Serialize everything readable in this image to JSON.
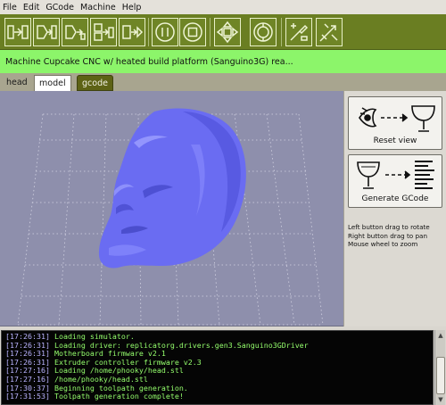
{
  "menubar": {
    "items": [
      "File",
      "Edit",
      "GCode",
      "Machine",
      "Help"
    ]
  },
  "toolbar": {
    "buttons": [
      {
        "name": "simulate-button",
        "icon": "simulate-icon"
      },
      {
        "name": "build-button",
        "icon": "build-icon"
      },
      {
        "name": "upload-button",
        "icon": "upload-icon"
      },
      {
        "name": "build-to-file-button",
        "icon": "build-to-file-icon"
      },
      {
        "name": "build-from-file-button",
        "icon": "build-from-file-icon"
      },
      {
        "name": "pause-button",
        "icon": "pause-icon"
      },
      {
        "name": "stop-button",
        "icon": "stop-icon"
      },
      {
        "name": "control-panel-button",
        "icon": "jog-arrows-icon"
      },
      {
        "name": "reset-button",
        "icon": "reset-icon"
      },
      {
        "name": "extruder-button",
        "icon": "extruder-icon"
      },
      {
        "name": "machine-config-button",
        "icon": "machine-config-icon"
      }
    ]
  },
  "status": {
    "text": "Machine Cupcake CNC w/ heated build platform (Sanguino3G) rea..."
  },
  "tabs": [
    {
      "label": "head"
    },
    {
      "label": "model"
    },
    {
      "label": "gcode"
    }
  ],
  "side_panel": {
    "reset_view_label": "Reset view",
    "generate_gcode_label": "Generate GCode",
    "help_lines": [
      "Left button drag to rotate",
      "Right button drag to pan",
      "Mouse wheel to zoom"
    ]
  },
  "console": {
    "lines": [
      {
        "ts": "[17:26:31]",
        "msg": "Loading simulator."
      },
      {
        "ts": "[17:26:31]",
        "msg": "Loading driver: replicatorg.drivers.gen3.Sanguino3GDriver"
      },
      {
        "ts": "[17:26:31]",
        "msg": "Motherboard firmware v2.1"
      },
      {
        "ts": "[17:26:31]",
        "msg": "Extruder controller firmware v2.3"
      },
      {
        "ts": "[17:27:16]",
        "msg": "Loading /home/phooky/head.stl"
      },
      {
        "ts": "[17:27:16]",
        "msg": "/home/phooky/head.stl"
      },
      {
        "ts": "[17:30:37]",
        "msg": "Beginning toolpath generation."
      },
      {
        "ts": "[17:31:53]",
        "msg": "Toolpath generation complete!"
      }
    ]
  },
  "colors": {
    "toolbar": "#6a7e22",
    "status": "#8cf56a",
    "viewport": "#8e8fac",
    "model": "#6a6cf2",
    "console_bg": "#050505",
    "console_text": "#95ff6d",
    "console_ts": "#b9b3ff"
  }
}
